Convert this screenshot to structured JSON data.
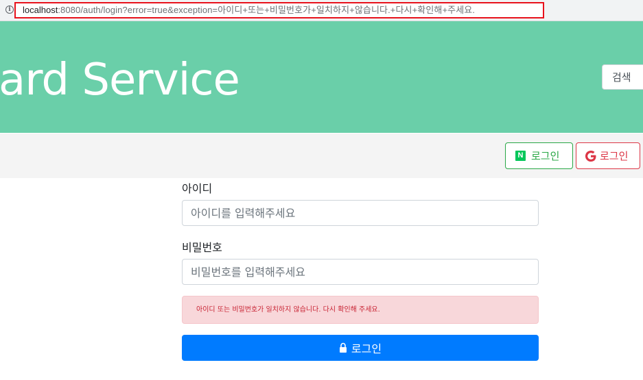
{
  "browser": {
    "url_host": "localhost",
    "url_rest": ":8080/auth/login?error=true&exception=아이디+또는+비밀번호가+일치하지+않습니다.+다시+확인해+주세요.",
    "info_icon": "info-icon"
  },
  "header": {
    "brand": "ard Service",
    "search_label": "검색",
    "bg_color": "#6acfa9"
  },
  "nav": {
    "naver_icon_glyph": "N",
    "naver_login_label": "로그인",
    "google_login_label": "로그인"
  },
  "form": {
    "id_label": "아이디",
    "id_placeholder": "아이디를 입력해주세요",
    "id_value": "",
    "pw_label": "비밀번호",
    "pw_placeholder": "비밀번호를 입력해주세요",
    "pw_value": "",
    "error_message": "아이디 또는 비밀번호가 일치하지 않습니다. 다시 확인해 주세요.",
    "submit_label": "로그인"
  },
  "colors": {
    "primary": "#007bff",
    "success": "#28a745",
    "danger": "#dc3545",
    "alert_bg": "#f8d7da"
  }
}
